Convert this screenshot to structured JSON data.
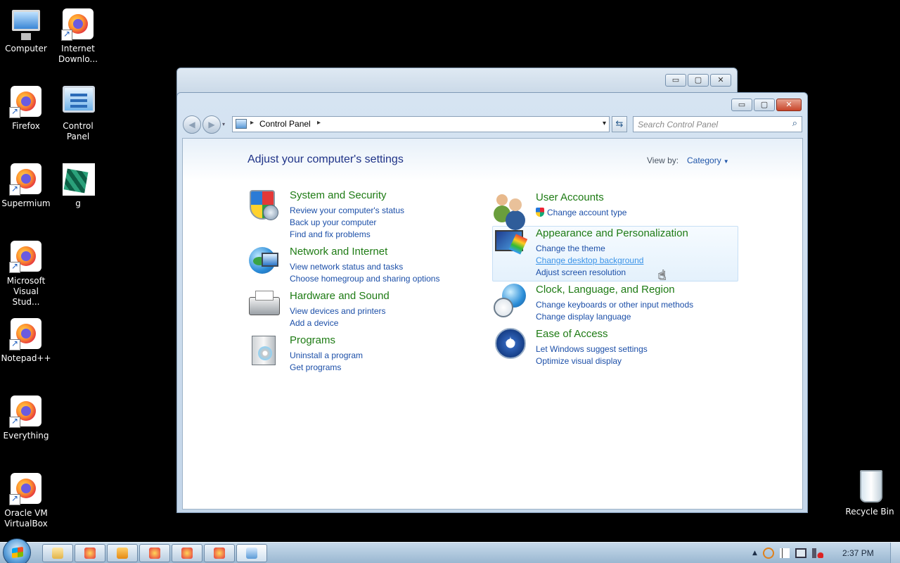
{
  "desktop": {
    "icons": [
      {
        "label": "Computer"
      },
      {
        "label": "Internet Downlo..."
      },
      {
        "label": "Firefox"
      },
      {
        "label": "Control Panel"
      },
      {
        "label": "Supermium"
      },
      {
        "label": "g"
      },
      {
        "label": "Microsoft Visual Stud..."
      },
      {
        "label": "Notepad++"
      },
      {
        "label": "Everything"
      },
      {
        "label": "Oracle VM VirtualBox"
      },
      {
        "label": "Recycle Bin"
      }
    ]
  },
  "back_window": {
    "buttons": {
      "minimize": "▭",
      "maximize": "▢",
      "close": "✕"
    }
  },
  "window": {
    "buttons": {
      "minimize": "▭",
      "maximize": "▢",
      "close": "✕"
    },
    "nav": {
      "back_glyph": "◀",
      "forward_glyph": "▶",
      "dropdown_glyph": "▾"
    },
    "address": {
      "breadcrumb": "Control Panel",
      "sep1": "▸",
      "sep2": "▸",
      "dropdown_glyph": "▾",
      "refresh_glyph": "⇆"
    },
    "search": {
      "placeholder": "Search Control Panel",
      "icon_glyph": "⌕"
    },
    "page_title": "Adjust your computer's settings",
    "view_by": {
      "label": "View by:",
      "value": "Category",
      "caret": "▼"
    },
    "categories": [
      {
        "title": "System and Security",
        "links": [
          "Review your computer's status",
          "Back up your computer",
          "Find and fix problems"
        ]
      },
      {
        "title": "Network and Internet",
        "links": [
          "View network status and tasks",
          "Choose homegroup and sharing options"
        ]
      },
      {
        "title": "Hardware and Sound",
        "links": [
          "View devices and printers",
          "Add a device"
        ]
      },
      {
        "title": "Programs",
        "links": [
          "Uninstall a program",
          "Get programs"
        ]
      },
      {
        "title": "User Accounts",
        "links": [
          "Change account type"
        ]
      },
      {
        "title": "Appearance and Personalization",
        "links": [
          "Change the theme",
          "Change desktop background",
          "Adjust screen resolution"
        ]
      },
      {
        "title": "Clock, Language, and Region",
        "links": [
          "Change keyboards or other input methods",
          "Change display language"
        ]
      },
      {
        "title": "Ease of Access",
        "links": [
          "Let Windows suggest settings",
          "Optimize visual display"
        ]
      }
    ],
    "colors": {
      "category_title": "#1e7b14",
      "link": "#1c4fa8",
      "link_hover": "#3a93e8",
      "page_title": "#1e3287"
    }
  },
  "taskbar": {
    "pinned": [
      "folder-icon",
      "firefox-icon",
      "media-player-icon",
      "firefox-icon",
      "firefox-icon",
      "firefox-icon",
      "control-panel-icon"
    ],
    "tray": {
      "arrow": "▲",
      "icons": [
        "search-icon",
        "flag-icon",
        "network-icon",
        "volume-muted-icon"
      ]
    },
    "clock": "2:37 PM"
  }
}
